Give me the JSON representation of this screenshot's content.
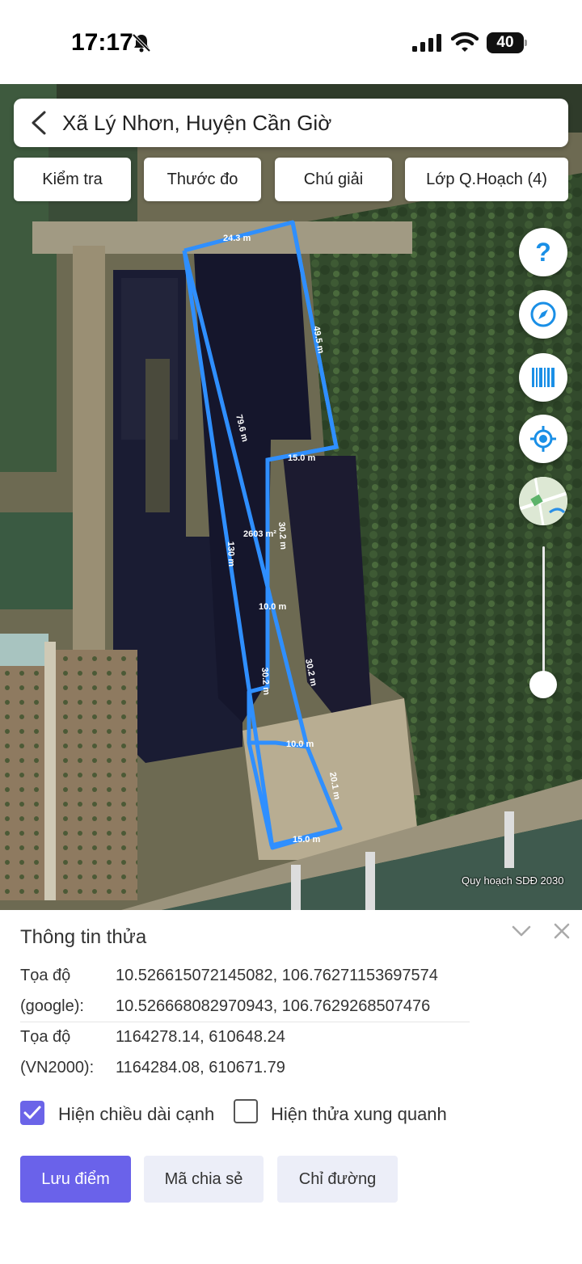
{
  "status_bar": {
    "time": "17:17",
    "battery": "40",
    "icons": [
      "bell-slash-icon",
      "signal-icon",
      "wifi-icon",
      "battery-icon"
    ]
  },
  "search": {
    "location": "Xã Lý Nhơn, Huyện Cần Giờ"
  },
  "map_tabs": [
    {
      "label": "Kiểm tra"
    },
    {
      "label": "Thước đo"
    },
    {
      "label": "Chú giải"
    },
    {
      "label": "Lớp Q.Hoạch (4)"
    }
  ],
  "map_controls": [
    "help-icon",
    "compass-icon",
    "barcode-icon",
    "locate-icon",
    "minimap-icon"
  ],
  "zoom_level": 0.1,
  "map_credit": "Quy hoạch SDĐ 2030",
  "parcel": {
    "color": "#2f8fff",
    "area_label": "2603 m²",
    "dimensions": {
      "top": "24.3 m",
      "right_upper": "49.5 m",
      "notch": "15.0 m",
      "diagonal": "79.6 m",
      "inner_right": "30.2 m",
      "left": "130 m",
      "inner_top": "10.0 m",
      "inner_left": "30.2 m",
      "inner_right_lower": "30.2 m",
      "inner_bottom": "10.0 m",
      "right_lower": "20.1 m",
      "bottom": "15.0 m"
    }
  },
  "panel": {
    "title": "Thông tin thửa",
    "google": {
      "label_line1": "Tọa độ",
      "label_line2": "(google):",
      "value1": "10.526615072145082, 106.76271153697574",
      "value2": "10.526668082970943, 106.7629268507476"
    },
    "vn2000": {
      "label_line1": "Tọa độ",
      "label_line2": "(VN2000):",
      "value1": "1164278.14, 610648.24",
      "value2": "1164284.08, 610671.79"
    },
    "show_edge_lengths": {
      "label": "Hiện chiều dài cạnh",
      "checked": true
    },
    "show_neighbors": {
      "label": "Hiện thửa xung quanh",
      "checked": false
    },
    "buttons": {
      "save": "Lưu điểm",
      "share": "Mã chia sẻ",
      "directions": "Chỉ đường"
    },
    "accent_color": "#6a62ea"
  }
}
